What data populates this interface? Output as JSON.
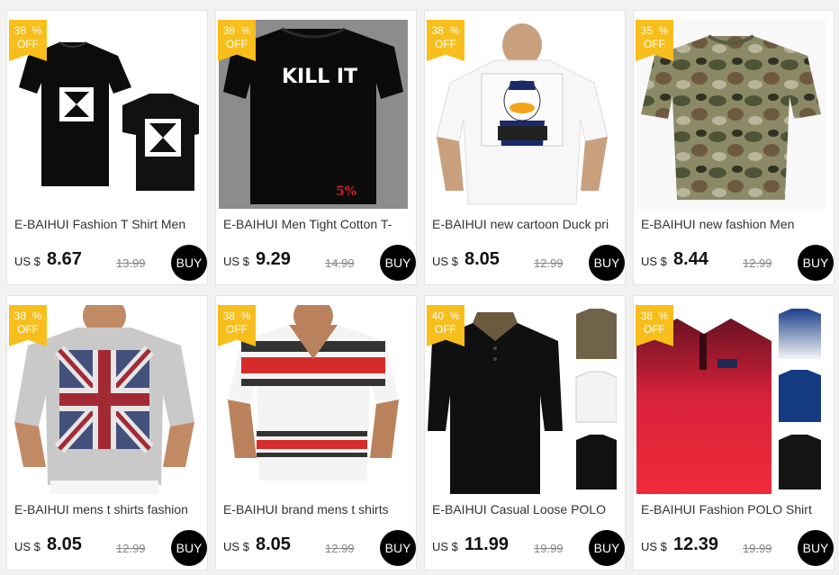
{
  "products": [
    {
      "title": "E-BAIHUI Fashion T Shirt Men",
      "currency": "US $",
      "price": "8.67",
      "old_price": "13.99",
      "discount": "38",
      "pct": "%",
      "off": "OFF",
      "buy": "BUY",
      "image": "choppers-black-tees"
    },
    {
      "title": "E-BAIHUI Men Tight Cotton T-",
      "currency": "US $",
      "price": "9.29",
      "old_price": "14.99",
      "discount": "38",
      "pct": "%",
      "off": "OFF",
      "buy": "BUY",
      "image": "kill-it-black-tee",
      "print_text": "KILL IT",
      "print_small": "5%"
    },
    {
      "title": "E-BAIHUI new cartoon Duck print",
      "currency": "US $",
      "price": "8.05",
      "old_price": "12.99",
      "discount": "38",
      "pct": "%",
      "off": "OFF",
      "buy": "BUY",
      "image": "duck-white-tee"
    },
    {
      "title": "E-BAIHUI new fashion Men",
      "currency": "US $",
      "price": "8.44",
      "old_price": "12.99",
      "discount": "35",
      "pct": "%",
      "off": "OFF",
      "buy": "BUY",
      "image": "camo-tee"
    },
    {
      "title": "E-BAIHUI mens t shirts fashion",
      "currency": "US $",
      "price": "8.05",
      "old_price": "12.99",
      "discount": "38",
      "pct": "%",
      "off": "OFF",
      "buy": "BUY",
      "image": "union-jack-tee"
    },
    {
      "title": "E-BAIHUI brand mens t shirts",
      "currency": "US $",
      "price": "8.05",
      "old_price": "12.99",
      "discount": "38",
      "pct": "%",
      "off": "OFF",
      "buy": "BUY",
      "image": "tribal-print-tee"
    },
    {
      "title": "E-BAIHUI Casual Loose POLO",
      "currency": "US $",
      "price": "11.99",
      "old_price": "19.99",
      "discount": "40",
      "pct": "%",
      "off": "OFF",
      "buy": "BUY",
      "image": "black-polo"
    },
    {
      "title": "E-BAIHUI Fashion POLO Shirt",
      "currency": "US $",
      "price": "12.39",
      "old_price": "19.99",
      "discount": "38",
      "pct": "%",
      "off": "OFF",
      "buy": "BUY",
      "image": "red-gradient-polo"
    }
  ],
  "colors": {
    "badge": "#f7be1c",
    "buy": "#000000",
    "card_border": "#e3e3e3",
    "background": "#f2f2f2"
  }
}
